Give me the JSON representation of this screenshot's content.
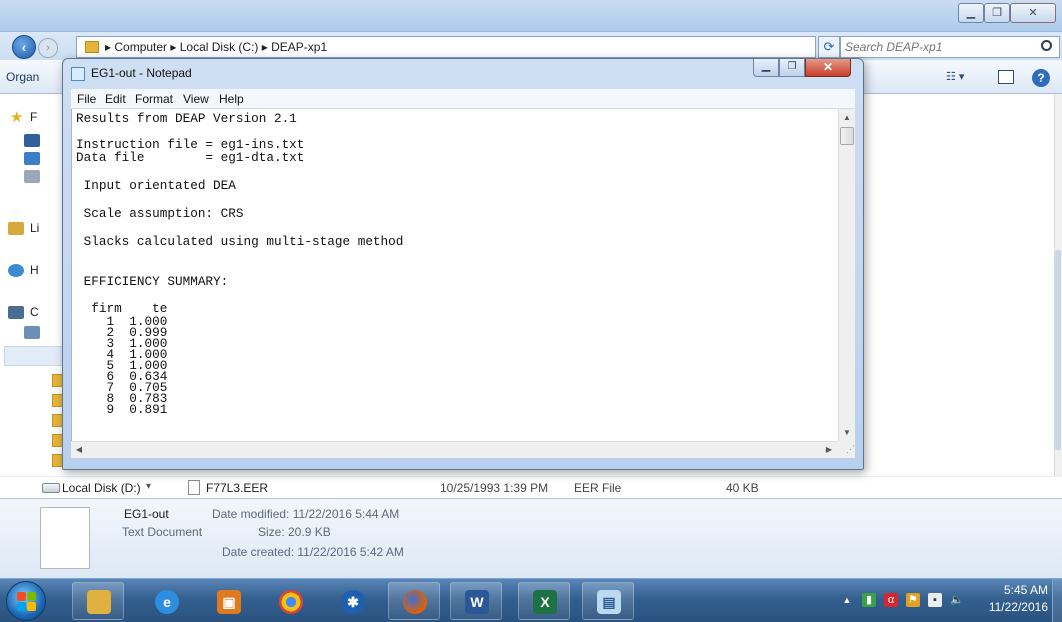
{
  "explorer": {
    "title": "",
    "address_path": "▸ Computer ▸ Local Disk (C:) ▸ DEAP-xp1",
    "search_placeholder": "Search DEAP-xp1",
    "organize": "Organ",
    "nav": {
      "favorites_label": "F",
      "libraries_label": "Li",
      "homegroup_label": "H",
      "computer_label": "C"
    },
    "file_row": {
      "drive_label": "Local Disk (D:)",
      "name": "F77L3.EER",
      "date": "10/25/1993 1:39 PM",
      "type": "EER File",
      "size": "40 KB"
    },
    "details": {
      "name": "EG1-out",
      "type": "Text Document",
      "modified": "Date modified: 11/22/2016 5:44 AM",
      "size": "Size: 20.9 KB",
      "created": "Date created: 11/22/2016 5:42 AM"
    }
  },
  "notepad": {
    "title": "EG1-out - Notepad",
    "menu": [
      "File",
      "Edit",
      "Format",
      "View",
      "Help"
    ],
    "lines": [
      "Results from DEAP Version 2.1",
      "",
      "Instruction file = eg1-ins.txt",
      "Data file        = eg1-dta.txt",
      "",
      " Input orientated DEA",
      "",
      " Scale assumption: CRS",
      "",
      " Slacks calculated using multi-stage method",
      "",
      "",
      " EFFICIENCY SUMMARY:",
      "",
      "  firm    te",
      "    1  1.000",
      "    2  0.999",
      "    3  1.000",
      "    4  1.000",
      "    5  1.000",
      "    6  0.634",
      "    7  0.705",
      "    8  0.783",
      "    9  0.891"
    ]
  },
  "taskbar": {
    "time": "5:45 AM",
    "date": "11/22/2016"
  }
}
